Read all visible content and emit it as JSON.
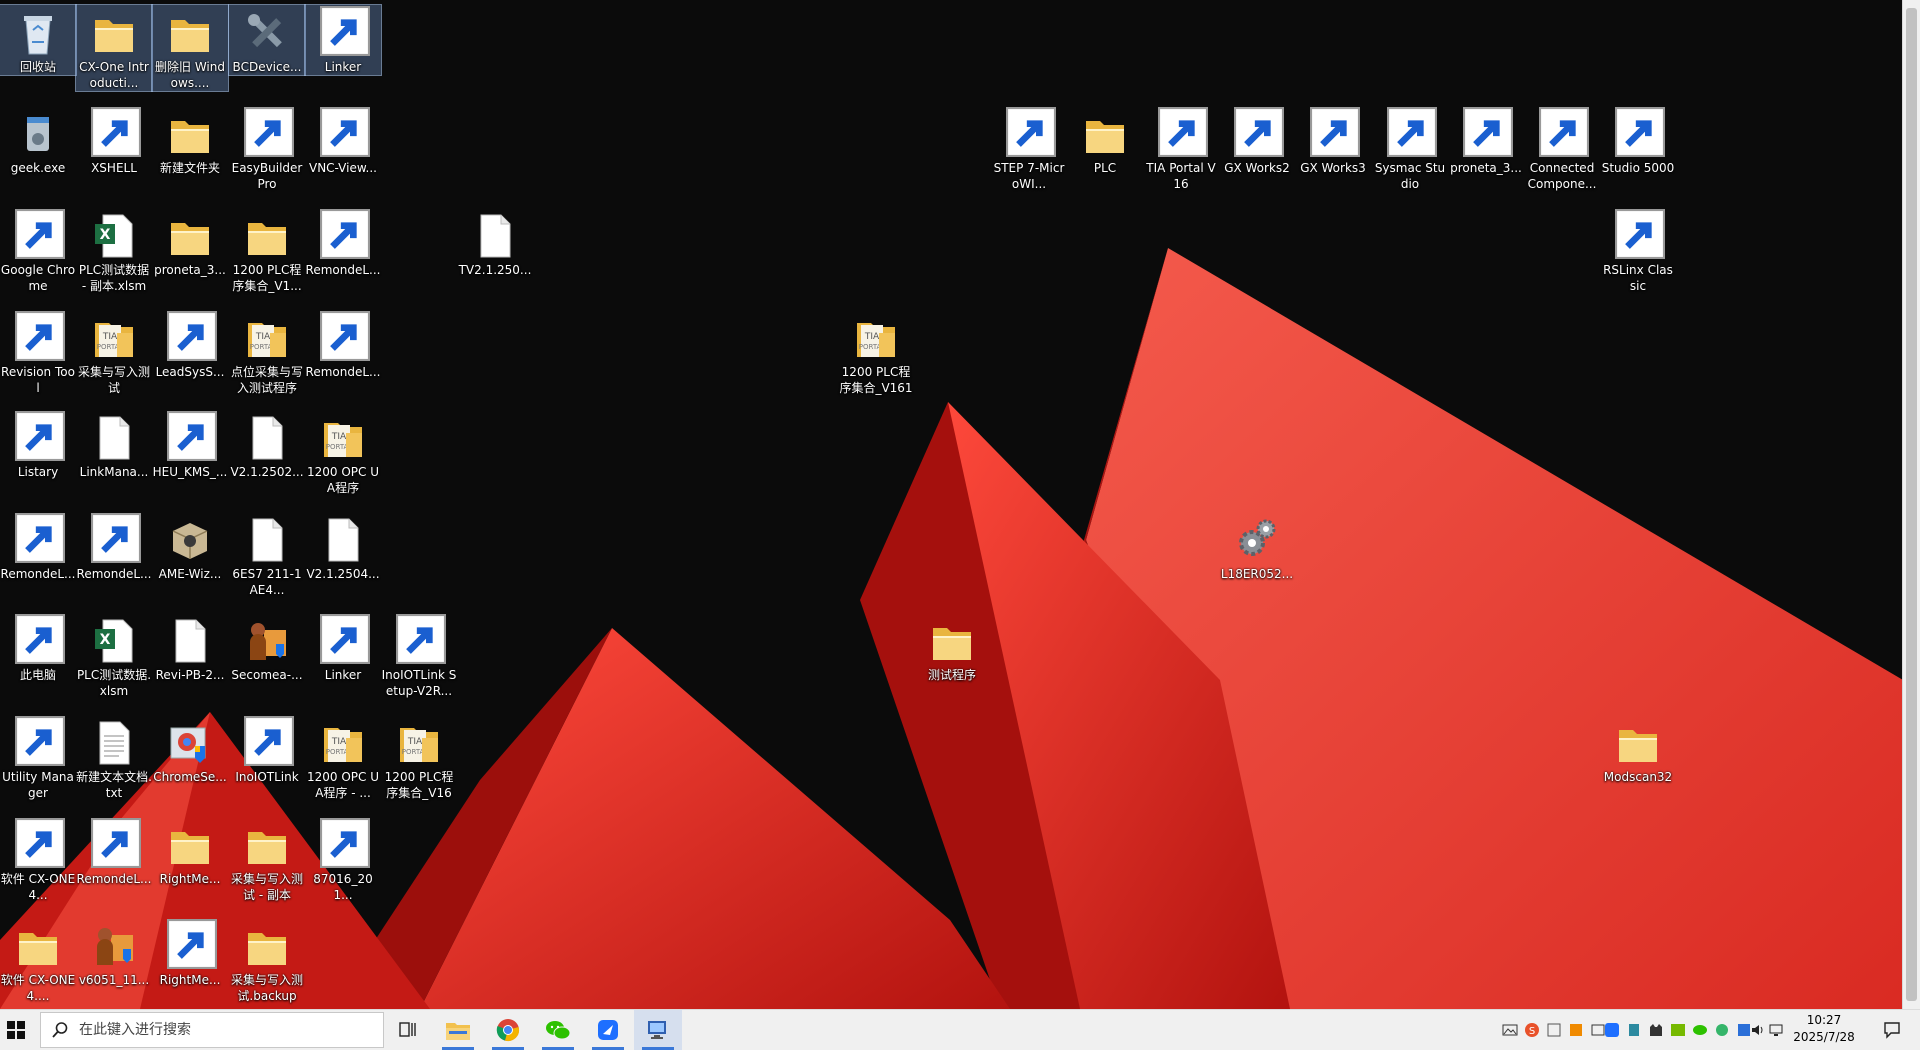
{
  "desktop": {
    "icons": [
      {
        "label": "回收站",
        "icon": "recycle-bin-icon"
      },
      {
        "label": "CX-One Introducti...",
        "icon": "folder-icon"
      },
      {
        "label": "删除旧 Windows....",
        "icon": "folder-icon"
      },
      {
        "label": "BCDevice...",
        "icon": "tools-icon"
      },
      {
        "label": "Linker",
        "icon": "link-icon"
      },
      {
        "label": "geek.exe",
        "icon": "geek-icon"
      },
      {
        "label": "XSHELL",
        "icon": "xshell-icon"
      },
      {
        "label": "新建文件夹",
        "icon": "folder-icon"
      },
      {
        "label": "EasyBuilder Pro",
        "icon": "easybuilder-icon"
      },
      {
        "label": "VNC-View...",
        "icon": "vnc-icon"
      },
      {
        "label": "Google Chrome",
        "icon": "chrome-icon"
      },
      {
        "label": "PLC测试数据 - 副本.xlsm",
        "icon": "excel-icon"
      },
      {
        "label": "proneta_3...",
        "icon": "folder-icon"
      },
      {
        "label": "1200 PLC程序集合_V1...",
        "icon": "folder-icon"
      },
      {
        "label": "RemondeL...",
        "icon": "link-icon"
      },
      {
        "label": "Revision Tool",
        "icon": "revision-tool-icon"
      },
      {
        "label": "采集与写入测试",
        "icon": "tia-folder-icon"
      },
      {
        "label": "LeadSysS...",
        "icon": "leadsys-icon"
      },
      {
        "label": "点位采集与写入测试程序",
        "icon": "tia-folder-icon"
      },
      {
        "label": "RemondeL...",
        "icon": "link-icon"
      },
      {
        "label": "Listary",
        "icon": "listary-icon"
      },
      {
        "label": "LinkMana...",
        "icon": "file-icon"
      },
      {
        "label": "HEU_KMS_...",
        "icon": "heu-kms-icon"
      },
      {
        "label": "V2.1.2502...",
        "icon": "file-icon"
      },
      {
        "label": "1200 OPC UA程序",
        "icon": "tia-folder-icon"
      },
      {
        "label": "RemondeL...",
        "icon": "link-icon"
      },
      {
        "label": "RemondeL...",
        "icon": "link-icon"
      },
      {
        "label": "AME-Wiz...",
        "icon": "box-icon"
      },
      {
        "label": "6ES7 211-1AE4...",
        "icon": "file-icon"
      },
      {
        "label": "V2.1.2504...",
        "icon": "file-icon"
      },
      {
        "label": "此电脑",
        "icon": "computer-icon"
      },
      {
        "label": "PLC测试数据.xlsm",
        "icon": "excel-icon"
      },
      {
        "label": "Revi-PB-2...",
        "icon": "file-icon"
      },
      {
        "label": "Secomea-...",
        "icon": "installer-icon"
      },
      {
        "label": "Linker",
        "icon": "link-icon"
      },
      {
        "label": "InoIOTLink Setup-V2R...",
        "icon": "iot-icon"
      },
      {
        "label": "Utility Manager",
        "icon": "utility-manager-icon"
      },
      {
        "label": "新建文本文档.txt",
        "icon": "text-file-icon"
      },
      {
        "label": "ChromeSe...",
        "icon": "chrome-setup-icon"
      },
      {
        "label": "InoIOTLink",
        "icon": "iot-icon"
      },
      {
        "label": "1200 OPC UA程序 - ...",
        "icon": "tia-folder-icon"
      },
      {
        "label": "1200 PLC程序集合_V16",
        "icon": "tia-folder-icon"
      },
      {
        "label": "软件 CX-ONE4...",
        "icon": "zip-icon"
      },
      {
        "label": "RemondeL...",
        "icon": "link-icon"
      },
      {
        "label": "RightMe...",
        "icon": "folder-icon"
      },
      {
        "label": "采集与写入测试 - 副本",
        "icon": "folder-icon"
      },
      {
        "label": "87016_201...",
        "icon": "zip-icon"
      },
      {
        "label": "软件 CX-ONE4....",
        "icon": "folder-icon"
      },
      {
        "label": "v6051_11...",
        "icon": "installer-icon"
      },
      {
        "label": "RightMe...",
        "icon": "zip-icon"
      },
      {
        "label": "采集与写入测试.backup",
        "icon": "folder-icon"
      },
      {
        "label": "TV2.1.250...",
        "icon": "file-icon"
      },
      {
        "label": "1200 PLC程序集合_V161",
        "icon": "tia-folder-icon"
      },
      {
        "label": "测试程序",
        "icon": "folder-icon"
      },
      {
        "label": "L18ER052...",
        "icon": "gears-icon"
      },
      {
        "label": "STEP 7-MicroWI...",
        "icon": "step7-icon"
      },
      {
        "label": "PLC",
        "icon": "folder-icon"
      },
      {
        "label": "TIA Portal V16",
        "icon": "tia-portal-icon"
      },
      {
        "label": "GX Works2",
        "icon": "gxworks2-icon"
      },
      {
        "label": "GX Works3",
        "icon": "gxworks3-icon"
      },
      {
        "label": "Sysmac Studio",
        "icon": "sysmac-icon"
      },
      {
        "label": "proneta_3...",
        "icon": "zip-icon"
      },
      {
        "label": "Connected Compone...",
        "icon": "connected-components-icon"
      },
      {
        "label": "Studio 5000",
        "icon": "studio5000-icon"
      },
      {
        "label": "RSLinx Classic",
        "icon": "rslinx-icon"
      },
      {
        "label": "Modscan32",
        "icon": "folder-icon"
      }
    ]
  },
  "taskbar": {
    "search_placeholder": "在此键入进行搜索",
    "pinned": [
      {
        "name": "task-view",
        "icon": "task-view-icon"
      },
      {
        "name": "file-explorer",
        "icon": "folder-icon"
      },
      {
        "name": "chrome",
        "icon": "chrome-icon"
      },
      {
        "name": "wechat",
        "icon": "wechat-icon"
      },
      {
        "name": "feishu",
        "icon": "feishu-icon"
      },
      {
        "name": "remote-desktop",
        "icon": "remote-desktop-icon"
      }
    ],
    "clock": {
      "time": "10:27",
      "date": "2025/7/28"
    }
  },
  "colors": {
    "accent": "#3a78d8",
    "wallpaper_red": "#e0302a",
    "desktop_bg": "#0b0b0b"
  }
}
